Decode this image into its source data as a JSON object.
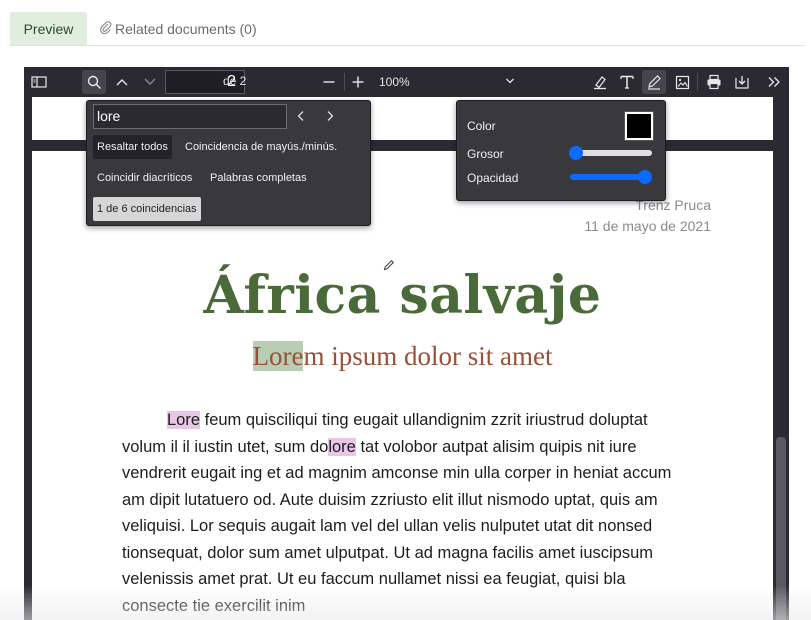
{
  "tabs": {
    "preview": "Preview",
    "related": "Related documents (0)"
  },
  "toolbar": {
    "page_number": "2",
    "page_of": "de 2",
    "zoom": "100%"
  },
  "find": {
    "query": "lore",
    "options": {
      "highlight_all": "Resaltar todos",
      "match_case": "Coincidencia de mayús./minús.",
      "match_diacritics": "Coincidir diacríticos",
      "whole_words": "Palabras completas"
    },
    "result_count": "1 de 6 coincidencias"
  },
  "ink": {
    "color_label": "Color",
    "thickness_label": "Grosor",
    "opacity_label": "Opacidad",
    "color_value": "#000000",
    "thickness_level": 0.0,
    "opacity_level": 1.0
  },
  "document": {
    "author": "Trenz Pruca",
    "date": "11 de mayo de 2021",
    "title": "África salvaje",
    "subtitle_hl": "Lore",
    "subtitle_rest": "m ipsum dolor sit amet",
    "para_hl1": "Lore",
    "para_a": " feum quisciliqui ting eugait ullandignim zzrit iriustrud doluptat volum il il iustin utet, sum do",
    "para_hl2": "lore",
    "para_b": " tat volobor autpat alisim quipis nit iure vendrerit eugait ing et ad magnim amconse min ulla corper in heniat accum am dipit lutatuero od. Aute duisim zzriusto elit illut nismodo uptat, quis am veliquisi. Lor sequis augait lam vel del ullan velis nulputet utat dit nonsed tionsequat, dolor sum amet ulputpat. Ut ad magna facilis amet iuscipsum velenissis amet prat. Ut eu faccum nullamet nissi ea feugiat, quisi bla consecte tie exercilit inim"
  },
  "colors": {
    "tab_active_bg": "#dfeedd",
    "toolbar_bg": "#2b2a33",
    "title_color": "#4b6a3a",
    "subtitle_color": "#9a4f37",
    "accent": "#0a6cff"
  }
}
